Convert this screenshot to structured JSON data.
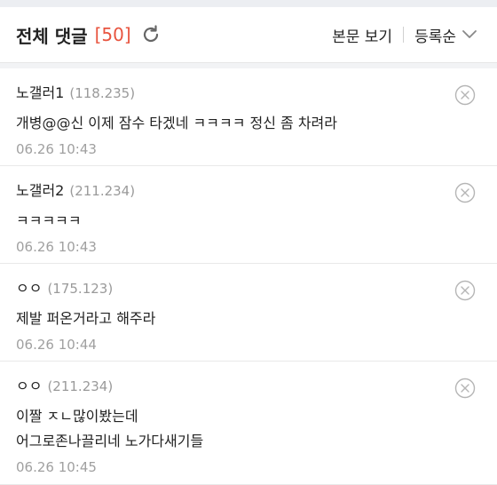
{
  "header": {
    "title": "전체 댓글",
    "count": "[50]",
    "view_body": "본문 보기",
    "sort_label": "등록순"
  },
  "comments": [
    {
      "nick": "노갤러1",
      "ip": "(118.235)",
      "text": "개병@@신 이제 잠수 타겠네 ㅋㅋㅋㅋ 정신 좀 차려라",
      "date": "06.26 10:43"
    },
    {
      "nick": "노갤러2",
      "ip": "(211.234)",
      "text": "ㅋㅋㅋㅋㅋ",
      "date": "06.26 10:43"
    },
    {
      "nick": "ㅇㅇ",
      "ip": "(175.123)",
      "text": "제발 퍼온거라고 해주라",
      "date": "06.26 10:44"
    },
    {
      "nick": "ㅇㅇ",
      "ip": "(211.234)",
      "text_line1": "이짤 ㅈㄴ많이봤는데",
      "text_line2": "어그로존나끌리네 노가다새기들",
      "date": "06.26 10:45"
    }
  ],
  "icons": {
    "refresh": "refresh-icon",
    "sort": "chevron-down-icon",
    "delete": "close-circle-icon"
  },
  "colors": {
    "count": "#e8543f",
    "muted": "#9a9a9a"
  }
}
